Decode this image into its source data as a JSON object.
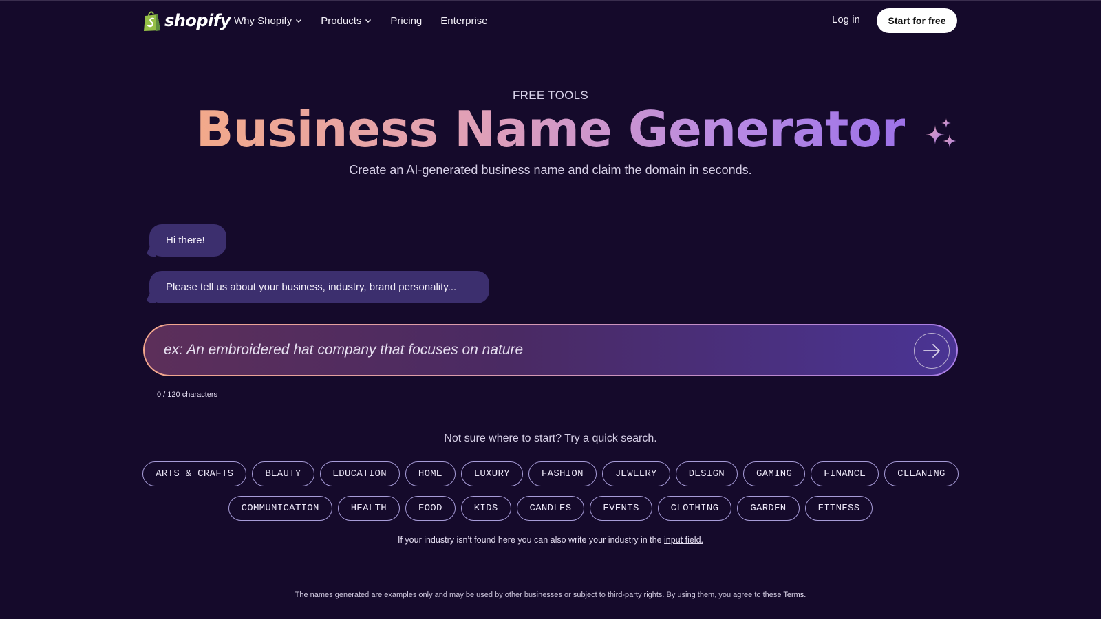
{
  "nav": {
    "brand": "shopify",
    "links": [
      {
        "label": "Why Shopify",
        "has_dropdown": true
      },
      {
        "label": "Products",
        "has_dropdown": true
      },
      {
        "label": "Pricing",
        "has_dropdown": false
      },
      {
        "label": "Enterprise",
        "has_dropdown": false
      }
    ],
    "login": "Log in",
    "cta": "Start for free"
  },
  "hero": {
    "eyebrow": "FREE TOOLS",
    "title": "Business Name Generator",
    "subtitle": "Create an AI-generated business name and claim the domain in seconds."
  },
  "chat": {
    "messages": [
      "Hi there!",
      "Please tell us about your business, industry, brand personality..."
    ]
  },
  "prompt": {
    "placeholder": "ex: An embroidered hat company that focuses on nature",
    "value": "",
    "counter": "0 / 120 characters"
  },
  "quick_search": {
    "heading": "Not sure where to start? Try a quick search.",
    "row1": [
      "ARTS & CRAFTS",
      "BEAUTY",
      "EDUCATION",
      "HOME",
      "LUXURY",
      "FASHION",
      "JEWELRY",
      "DESIGN",
      "GAMING",
      "FINANCE",
      "CLEANING"
    ],
    "row2": [
      "COMMUNICATION",
      "HEALTH",
      "FOOD",
      "KIDS",
      "CANDLES",
      "EVENTS",
      "CLOTHING",
      "GARDEN",
      "FITNESS"
    ],
    "hint_text": "If your industry isn’t found here you can also write your industry in the",
    "hint_link": "input field."
  },
  "footer": {
    "disclaimer": "The names generated are examples only and may be used by other businesses or subject to third-party rights. By using them, you agree to these",
    "terms_link": "Terms."
  },
  "colors": {
    "background": "#150a2b",
    "bubble": "#3c2f6e",
    "title_gradient_start": "#f2a98a",
    "title_gradient_end": "#9d72e8",
    "chip_border": "#a79cd8",
    "logo_green": "#95bf47"
  },
  "icons": [
    "shopify-bag-icon",
    "chevron-down-icon",
    "sparkle-icon",
    "arrow-right-icon"
  ]
}
